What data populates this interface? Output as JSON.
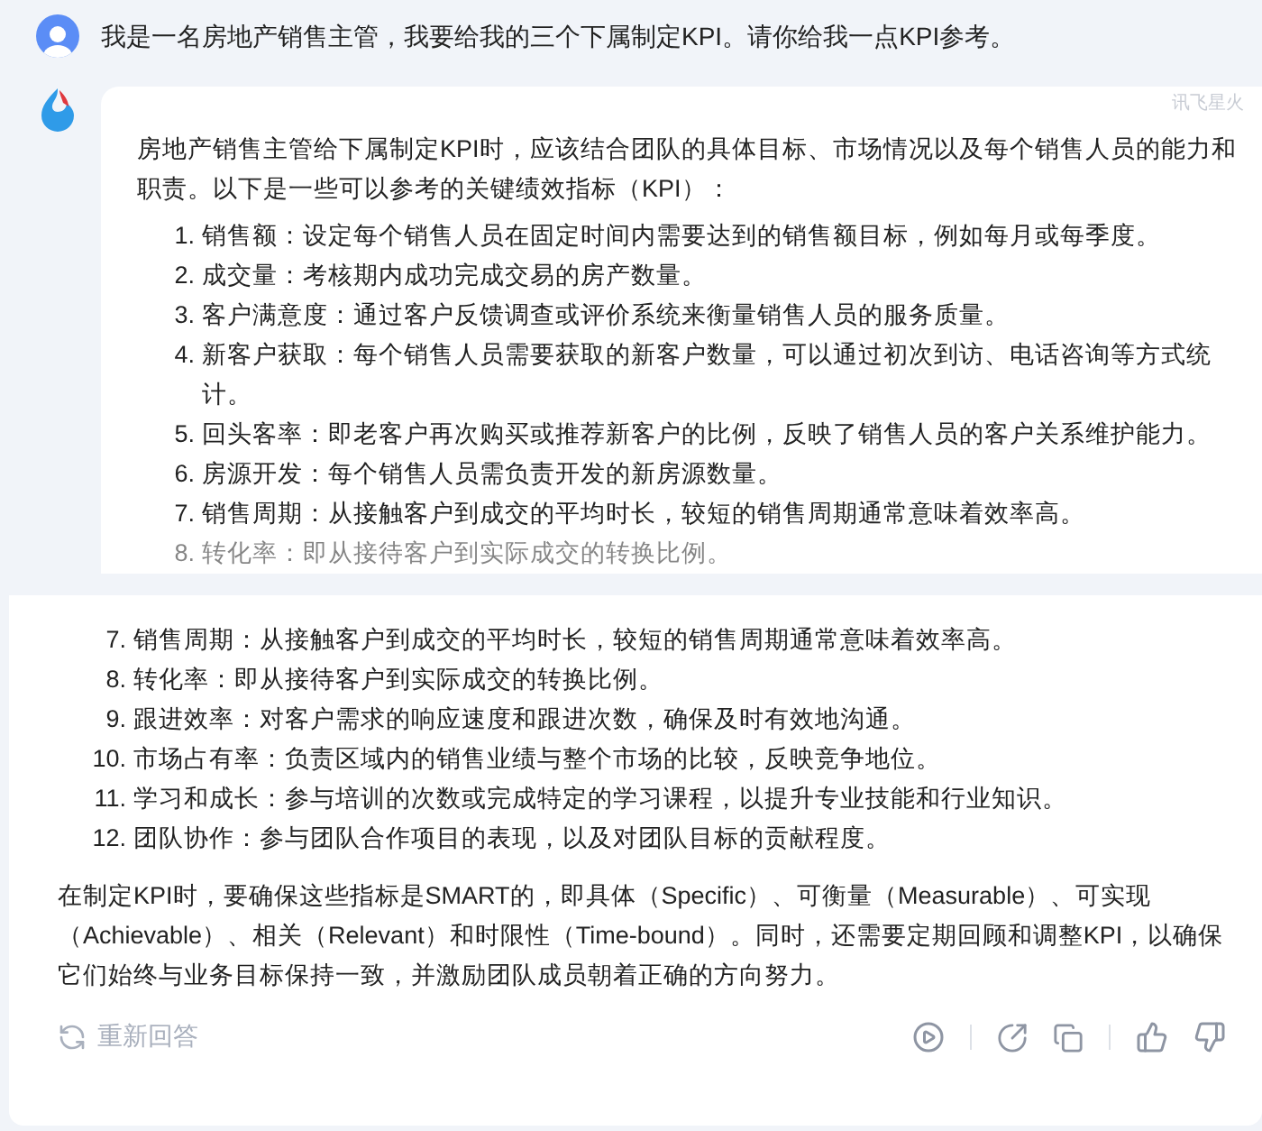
{
  "top_panel": {
    "user_message": "我是一名房地产销售主管，我要给我的三个下属制定KPI。请你给我一点KPI参考。",
    "answer": {
      "watermark": "讯飞星火",
      "intro": "房地产销售主管给下属制定KPI时，应该结合团队的具体目标、市场情况以及每个销售人员的能力和职责。以下是一些可以参考的关键绩效指标（KPI）：",
      "items": [
        {
          "number": "1.",
          "text": "销售额：设定每个销售人员在固定时间内需要达到的销售额目标，例如每月或每季度。",
          "faded": false
        },
        {
          "number": "2.",
          "text": "成交量：考核期内成功完成交易的房产数量。",
          "faded": false
        },
        {
          "number": "3.",
          "text": "客户满意度：通过客户反馈调查或评价系统来衡量销售人员的服务质量。",
          "faded": false
        },
        {
          "number": "4.",
          "text": "新客户获取：每个销售人员需要获取的新客户数量，可以通过初次到访、电话咨询等方式统计。",
          "faded": false
        },
        {
          "number": "5.",
          "text": "回头客率：即老客户再次购买或推荐新客户的比例，反映了销售人员的客户关系维护能力。",
          "faded": false
        },
        {
          "number": "6.",
          "text": "房源开发：每个销售人员需负责开发的新房源数量。",
          "faded": false
        },
        {
          "number": "7.",
          "text": "销售周期：从接触客户到成交的平均时长，较短的销售周期通常意味着效率高。",
          "faded": false
        },
        {
          "number": "8.",
          "text": "转化率：即从接待客户到实际成交的转换比例。",
          "faded": true
        }
      ]
    }
  },
  "bottom_panel": {
    "items": [
      {
        "number": "7.",
        "text": "销售周期：从接触客户到成交的平均时长，较短的销售周期通常意味着效率高。"
      },
      {
        "number": "8.",
        "text": "转化率：即从接待客户到实际成交的转换比例。"
      },
      {
        "number": "9.",
        "text": "跟进效率：对客户需求的响应速度和跟进次数，确保及时有效地沟通。"
      },
      {
        "number": "10.",
        "text": "市场占有率：负责区域内的销售业绩与整个市场的比较，反映竞争地位。"
      },
      {
        "number": "11.",
        "text": "学习和成长：参与培训的次数或完成特定的学习课程，以提升专业技能和行业知识。"
      },
      {
        "number": "12.",
        "text": "团队协作：参与团队合作项目的表现，以及对团队目标的贡献程度。"
      }
    ],
    "conclusion": "在制定KPI时，要确保这些指标是SMART的，即具体（Specific）、可衡量（Measurable）、可实现（Achievable）、相关（Relevant）和时限性（Time-bound）。同时，还需要定期回顾和调整KPI，以确保它们始终与业务目标保持一致，并激励团队成员朝着正确的方向努力。",
    "regenerate": "重新回答"
  }
}
